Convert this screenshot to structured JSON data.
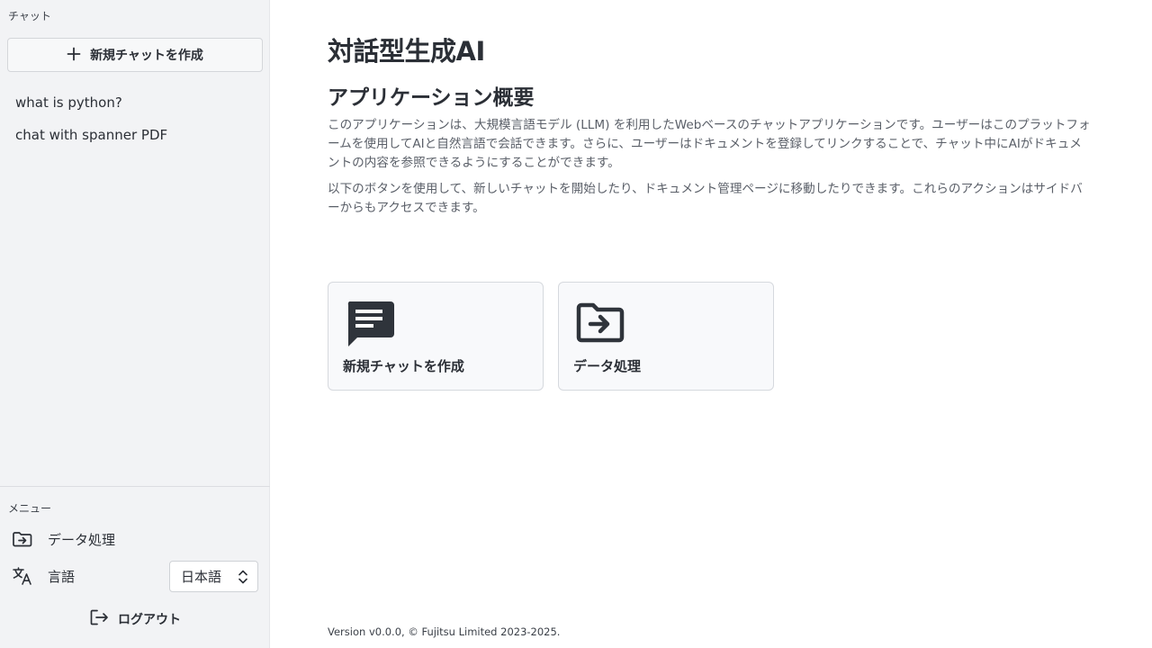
{
  "sidebar": {
    "chat_section_label": "チャット",
    "new_chat_label": "新規チャットを作成",
    "chats": [
      {
        "label": "what is python?"
      },
      {
        "label": "chat with spanner PDF"
      }
    ],
    "menu_section_label": "メニュー",
    "menu": {
      "data_processing_label": "データ処理",
      "language_label": "言語",
      "language_value": "日本語"
    },
    "logout_label": "ログアウト"
  },
  "main": {
    "title": "対話型生成AI",
    "section_title": "アプリケーション概要",
    "description_1": "このアプリケーションは、大規模言語モデル (LLM) を利用したWebベースのチャットアプリケーションです。ユーザーはこのプラットフォームを使用してAIと自然言語で会話できます。さらに、ユーザーはドキュメントを登録してリンクすることで、チャット中にAIがドキュメントの内容を参照できるようにすることができます。",
    "description_2": "以下のボタンを使用して、新しいチャットを開始したり、ドキュメント管理ページに移動したりできます。これらのアクションはサイドバーからもアクセスできます。",
    "cards": [
      {
        "label": "新規チャットを作成",
        "icon": "chat-icon"
      },
      {
        "label": "データ処理",
        "icon": "folder-arrow-icon"
      }
    ],
    "footer": "Version v0.0.0, © Fujitsu Limited 2023-2025."
  },
  "colors": {
    "sidebar_bg": "#f2f3f5",
    "text": "#2b2f36",
    "muted_text": "#5a5f68",
    "card_bg": "#f8f9fb",
    "border": "#d6d9de"
  }
}
